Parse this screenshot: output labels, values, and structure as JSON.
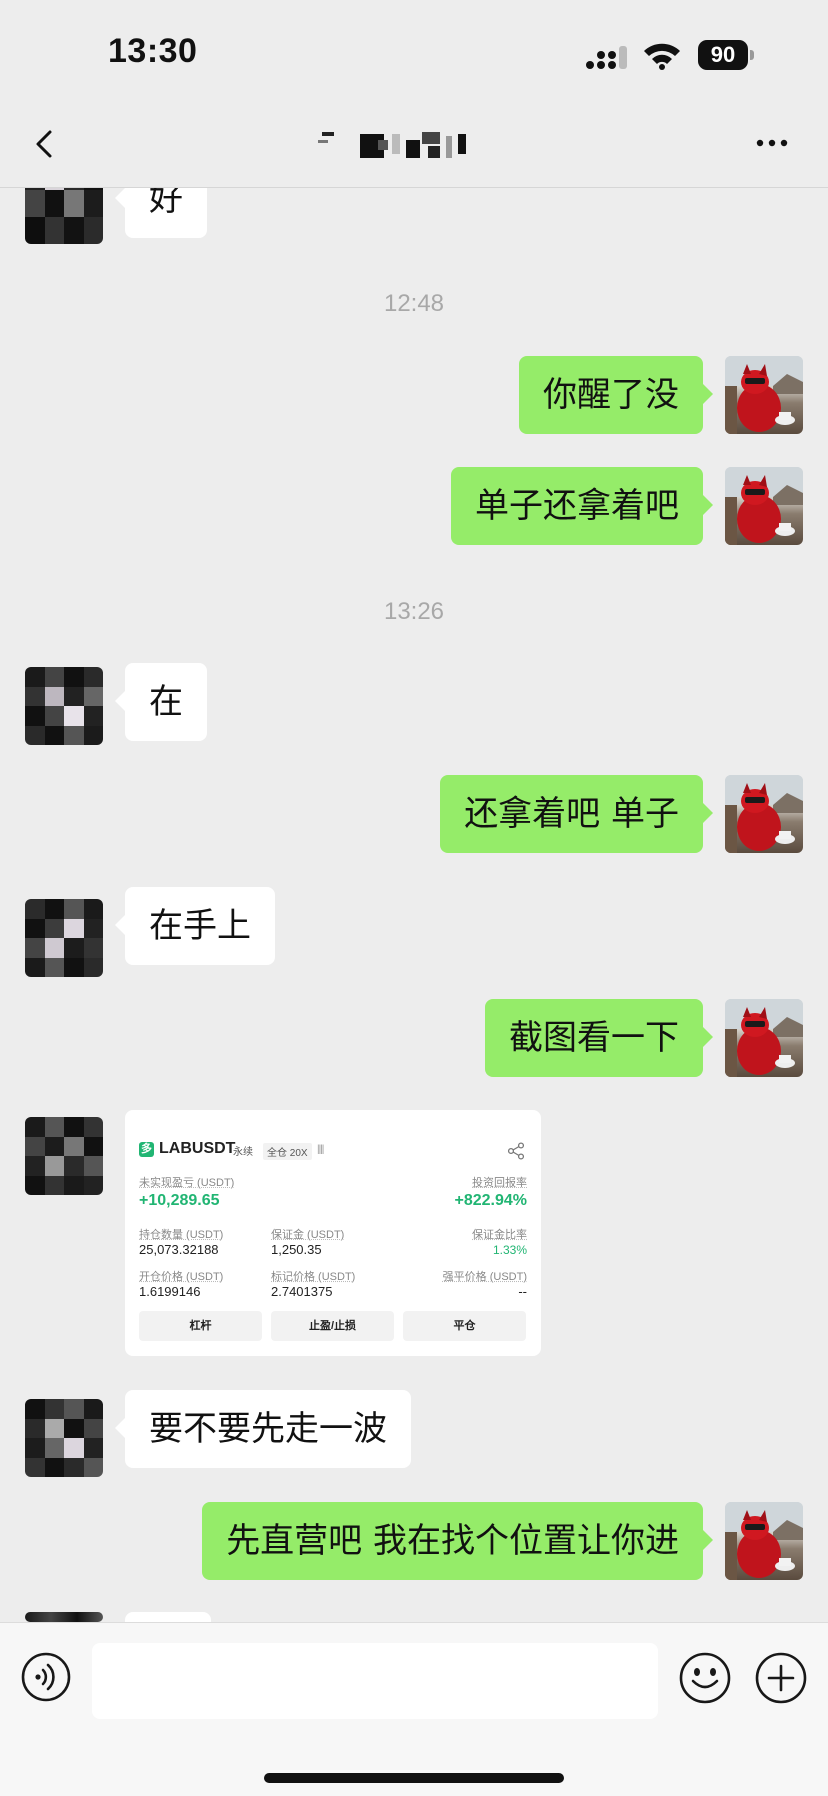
{
  "status_bar": {
    "time": "13:30",
    "battery": "90"
  },
  "nav": {
    "title": ""
  },
  "messages": [
    {
      "side": "in",
      "text": "好"
    },
    {
      "type": "time",
      "text": "12:48"
    },
    {
      "side": "out",
      "text": "你醒了没"
    },
    {
      "side": "out",
      "text": "单子还拿着吧"
    },
    {
      "type": "time",
      "text": "13:26"
    },
    {
      "side": "in",
      "text": "在"
    },
    {
      "side": "out",
      "text": "还拿着吧 单子"
    },
    {
      "side": "in",
      "text": "在手上"
    },
    {
      "side": "out",
      "text": "截图看一下"
    },
    {
      "side": "in",
      "type": "card"
    },
    {
      "side": "in",
      "text": "要不要先走一波"
    },
    {
      "side": "out",
      "text": "先直营吧 我在找个位置让你进"
    }
  ],
  "card": {
    "logo": "多",
    "symbol": "LABUSDT",
    "tag_perp": "永续",
    "tag_margin": "全仓 20X",
    "bars": "||||",
    "unrealized_label": "未实现盈亏 (USDT)",
    "unrealized_value": "+10,289.65",
    "roi_label": "投资回报率",
    "roi_value": "+822.94%",
    "position_label": "持仓数量 (USDT)",
    "position_value": "25,073.32188",
    "margin_label": "保证金 (USDT)",
    "margin_value": "1,250.35",
    "margin_ratio_label": "保证金比率",
    "margin_ratio_value": "1.33%",
    "entry_label": "开仓价格 (USDT)",
    "entry_value": "1.6199146",
    "mark_label": "标记价格 (USDT)",
    "mark_value": "2.7401375",
    "liq_label": "强平价格 (USDT)",
    "liq_value": "--",
    "btn_leverage": "杠杆",
    "btn_tpsl": "止盈/止损",
    "btn_close": "平仓"
  },
  "colors": {
    "outgoing_bubble": "#95ec69",
    "incoming_bubble": "#ffffff",
    "profit": "#21b573",
    "background": "#ededed"
  },
  "icons": {
    "back": "chevron-left-icon",
    "more": "more-dots-icon",
    "voice": "voice-icon",
    "emoji": "emoji-icon",
    "plus": "plus-icon",
    "share": "share-icon"
  }
}
